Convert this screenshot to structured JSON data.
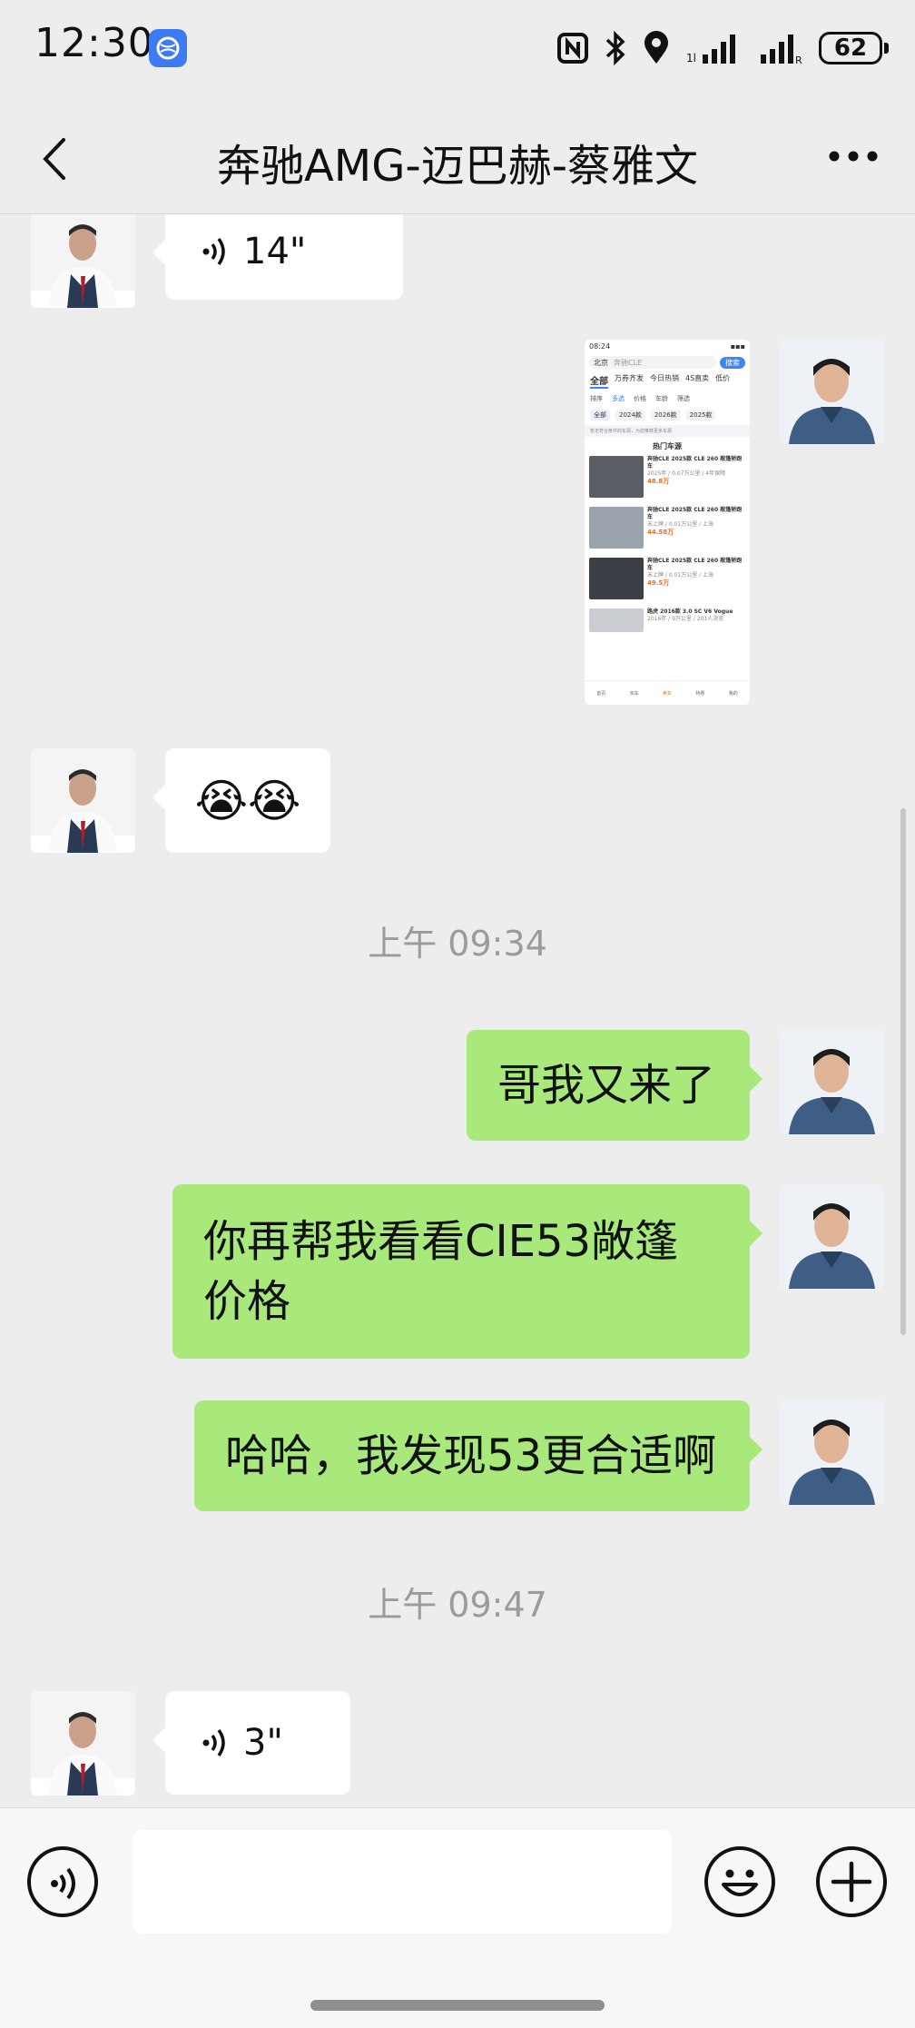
{
  "status_bar": {
    "time": "12:30",
    "battery": "62"
  },
  "header": {
    "title": "奔驰AMG-迈巴赫-蔡雅文"
  },
  "messages": {
    "voice1": {
      "duration": "14\""
    },
    "emoji": {
      "text": "😭😭"
    },
    "time1": "上午 09:34",
    "msg1": "哥我又来了",
    "msg2": "你再帮我看看CIE53敞篷价格",
    "msg3": "哈哈，我发现53更合适啊",
    "time2": "上午 09:47",
    "voice2": {
      "duration": "3\""
    }
  },
  "shared_screenshot": {
    "time": "08:24",
    "city": "北京",
    "search_query": "奔驰CLE",
    "search_button": "搜索",
    "tabs": [
      "全部",
      "万券齐发",
      "今日热销",
      "4S直卖",
      "低价"
    ],
    "filters": [
      "排序",
      "多选",
      "价格",
      "车龄",
      "筛选"
    ],
    "chips": [
      "全部",
      "2024款",
      "2026款",
      "2025款"
    ],
    "notice": "暂无符合条件的车源，为您推荐更多车源",
    "section_title": "热门车源",
    "listings": [
      {
        "title": "奔驰CLE 2025款 CLE 260 敞篷轿跑车",
        "meta": "2025年 / 0.07万公里 / 4年保障",
        "price": "48.8万"
      },
      {
        "title": "奔驰CLE 2025款 CLE 260 敞篷轿跑车",
        "meta": "未上牌 / 0.01万公里 / 上海",
        "price": "44.58万"
      },
      {
        "title": "奔驰CLE 2025款 CLE 260 敞篷轿跑车",
        "meta": "未上牌 / 0.01万公里 / 上海",
        "price": "49.5万"
      },
      {
        "title": "路虎 2016款 3.0 SC V6 Vogue",
        "meta": "2016年 / 9万公里 / 201人浏览",
        "price": ""
      }
    ],
    "bottom_nav": [
      "首页",
      "买车",
      "卖车",
      "特惠",
      "我的"
    ]
  },
  "icons": {
    "back": "chevron-left-icon",
    "more": "more-dots-icon",
    "voice": "voice-icon",
    "emoji": "smiley-icon",
    "plus": "plus-icon"
  }
}
